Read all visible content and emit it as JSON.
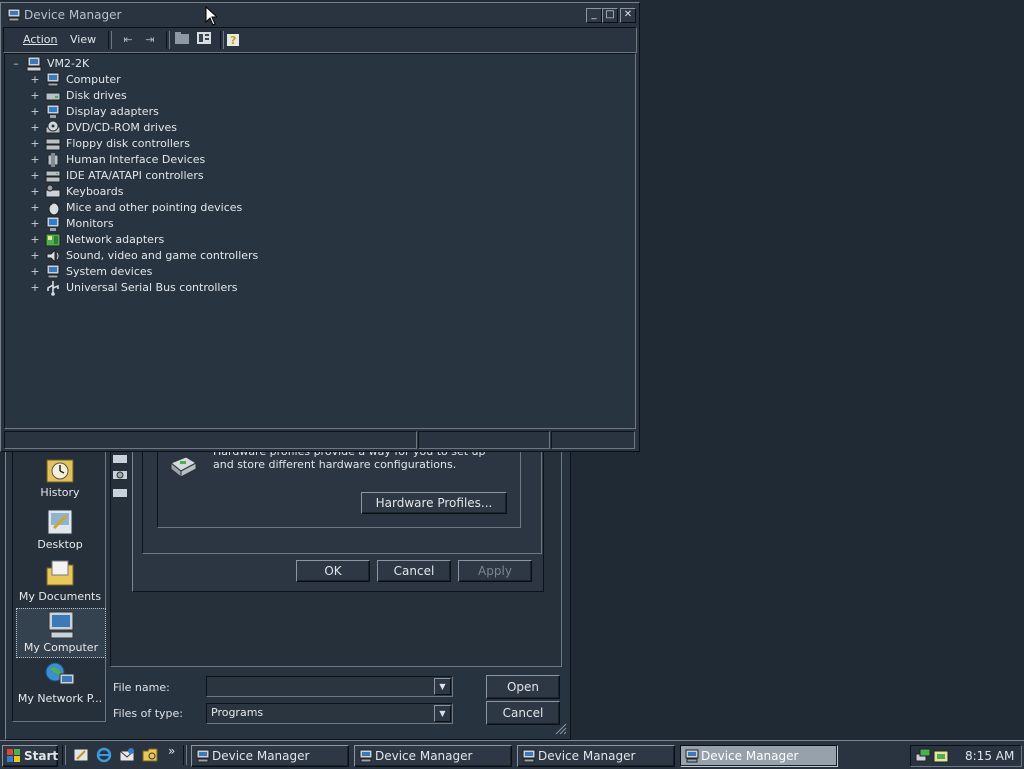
{
  "device_manager": {
    "title": "Device Manager",
    "menu": [
      "Action",
      "View"
    ],
    "toolbar_icons": [
      "back-icon",
      "forward-icon",
      "folder-up-icon",
      "properties-icon",
      "help-icon"
    ],
    "root": "VM2-2K",
    "categories": [
      {
        "label": "Computer",
        "icon": "computer-icon"
      },
      {
        "label": "Disk drives",
        "icon": "disk-drive-icon"
      },
      {
        "label": "Display adapters",
        "icon": "display-adapter-icon"
      },
      {
        "label": "DVD/CD-ROM drives",
        "icon": "cdrom-icon"
      },
      {
        "label": "Floppy disk controllers",
        "icon": "floppy-controller-icon"
      },
      {
        "label": "Human Interface Devices",
        "icon": "hid-icon"
      },
      {
        "label": "IDE ATA/ATAPI controllers",
        "icon": "ide-controller-icon"
      },
      {
        "label": "Keyboards",
        "icon": "keyboard-icon"
      },
      {
        "label": "Mice and other pointing devices",
        "icon": "mouse-icon"
      },
      {
        "label": "Monitors",
        "icon": "monitor-icon"
      },
      {
        "label": "Network adapters",
        "icon": "network-adapter-icon"
      },
      {
        "label": "Sound, video and game controllers",
        "icon": "sound-icon"
      },
      {
        "label": "System devices",
        "icon": "system-devices-icon"
      },
      {
        "label": "Universal Serial Bus controllers",
        "icon": "usb-icon"
      }
    ]
  },
  "hardware_profiles": {
    "description": "Hardware profiles provide a way for you to set up and store different hardware configurations.",
    "button": "Hardware Profiles...",
    "ok": "OK",
    "cancel": "Cancel",
    "apply": "Apply"
  },
  "open_dialog": {
    "places": [
      "History",
      "Desktop",
      "My Documents",
      "My Computer",
      "My Network P..."
    ],
    "file_name_label": "File name:",
    "file_name_value": "",
    "files_of_type_label": "Files of type:",
    "files_of_type_value": "Programs",
    "open_button": "Open",
    "cancel_button": "Cancel"
  },
  "taskbar": {
    "start": "Start",
    "chevron": "»",
    "tasks": [
      "Device Manager",
      "Device Manager",
      "Device Manager",
      "Device Manager"
    ],
    "active_task": 3,
    "clock": "8:15 AM"
  },
  "colors": {
    "desktop": "#1f2a35",
    "window": "#293440",
    "active_task": "#97a1ab"
  }
}
